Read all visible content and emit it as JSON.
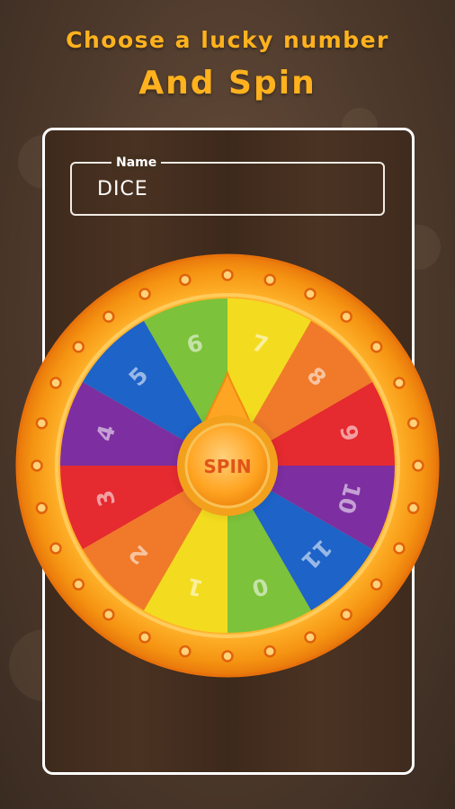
{
  "header": {
    "line1": "Choose a lucky number",
    "line2": "And Spin"
  },
  "name_field": {
    "label": "Name",
    "value": "DICE"
  },
  "wheel": {
    "segments": [
      {
        "label": "7",
        "color": "#f3dc1f"
      },
      {
        "label": "8",
        "color": "#f07a2a"
      },
      {
        "label": "9",
        "color": "#e52a30"
      },
      {
        "label": "10",
        "color": "#7d2ea0"
      },
      {
        "label": "11",
        "color": "#1d63c8"
      },
      {
        "label": "0",
        "color": "#7cc23a"
      },
      {
        "label": "1",
        "color": "#f3dc1f"
      },
      {
        "label": "2",
        "color": "#f07a2a"
      },
      {
        "label": "3",
        "color": "#e52a30"
      },
      {
        "label": "4",
        "color": "#7d2ea0"
      },
      {
        "label": "5",
        "color": "#1d63c8"
      },
      {
        "label": "6",
        "color": "#7cc23a"
      }
    ],
    "rim_color": "#f59b16",
    "spin_label": "SPIN"
  }
}
